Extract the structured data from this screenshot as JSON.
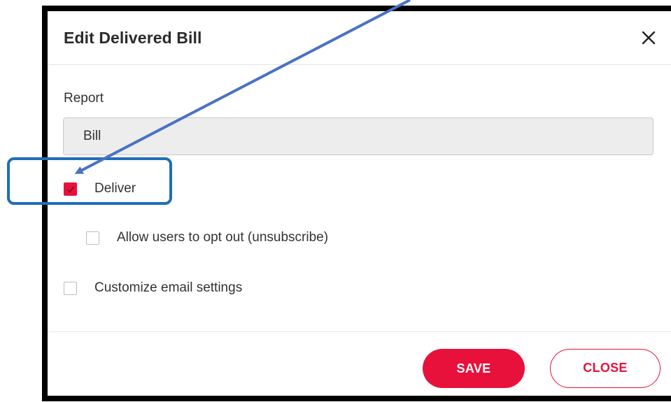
{
  "dialog": {
    "title": "Edit Delivered Bill",
    "close_icon": "close-x-icon"
  },
  "report": {
    "label": "Report",
    "value": "Bill"
  },
  "options": {
    "deliver": {
      "label": "Deliver",
      "checked": true
    },
    "opt_out": {
      "label": "Allow users to opt out (unsubscribe)",
      "checked": false
    },
    "customize_email": {
      "label": "Customize email settings",
      "checked": false
    }
  },
  "footer": {
    "save_label": "SAVE",
    "close_label": "CLOSE"
  },
  "colors": {
    "accent": "#e8113b",
    "annotation": "#1f6fb5",
    "arrow": "#4a72c4"
  }
}
